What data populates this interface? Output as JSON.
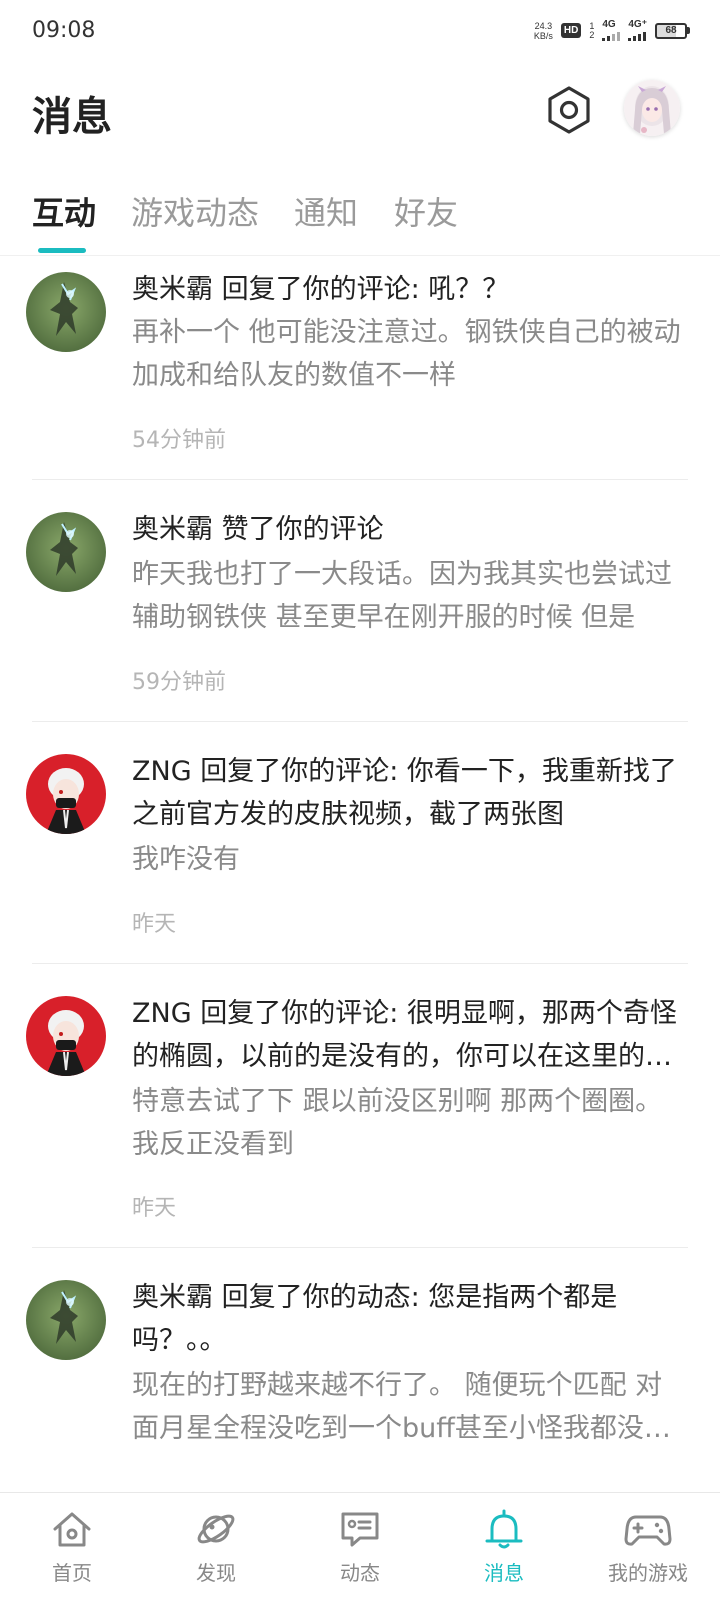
{
  "status_bar": {
    "time": "09:08",
    "net_speed_value": "24.3",
    "net_speed_unit": "KB/s",
    "hd_label": "HD",
    "sim_top": "1",
    "sim_bottom": "2",
    "signal1_label": "4G",
    "signal2_label": "4G⁺",
    "battery_level": "68"
  },
  "header": {
    "title": "消息",
    "settings_icon": "hexagon-settings-icon",
    "avatar": "anime-girl-avatar"
  },
  "tabs": [
    {
      "label": "互动",
      "active": true
    },
    {
      "label": "游戏动态",
      "active": false
    },
    {
      "label": "通知",
      "active": false
    },
    {
      "label": "好友",
      "active": false
    }
  ],
  "messages": [
    {
      "title": "奥米霸 回复了你的评论: 吼？？",
      "preview": "再补一个 他可能没注意过。钢铁侠自己的被动加成和给队友的数值不一样",
      "time": "54分钟前",
      "avatar": "green-hero-avatar"
    },
    {
      "title": "奥米霸 赞了你的评论",
      "preview": "昨天我也打了一大段话。因为我其实也尝试过辅助钢铁侠 甚至更早在刚开服的时候 但是",
      "time": "59分钟前",
      "avatar": "green-hero-avatar"
    },
    {
      "title": "ZNG 回复了你的评论: 你看一下，我重新找了之前官方发的皮肤视频，截了两张图",
      "preview": "我咋没有",
      "time": "昨天",
      "avatar": "red-ghoul-avatar"
    },
    {
      "title": "ZNG 回复了你的评论: 很明显啊，那两个奇怪的椭圆，以前的是没有的，你可以在这里的视频",
      "preview": "特意去试了下 跟以前没区别啊 那两个圈圈。我反正没看到",
      "time": "昨天",
      "avatar": "red-ghoul-avatar"
    },
    {
      "title": "奥米霸 回复了你的动态: 您是指两个都是吗？。。",
      "preview": "现在的打野越来越不行了。 随便玩个匹配 对面月星全程没吃到一个buff甚至小怪我都没有让",
      "time": "",
      "avatar": "green-hero-avatar"
    }
  ],
  "bottom_nav": [
    {
      "label": "首页",
      "icon": "home-icon",
      "active": false
    },
    {
      "label": "发现",
      "icon": "planet-icon",
      "active": false
    },
    {
      "label": "动态",
      "icon": "message-box-icon",
      "active": false
    },
    {
      "label": "消息",
      "icon": "bell-icon",
      "active": true
    },
    {
      "label": "我的游戏",
      "icon": "gamepad-icon",
      "active": false
    }
  ],
  "colors": {
    "accent": "#1bbcc0",
    "title_text": "#222222",
    "preview_text": "#8a8a8a",
    "time_text": "#b5b5b5"
  }
}
